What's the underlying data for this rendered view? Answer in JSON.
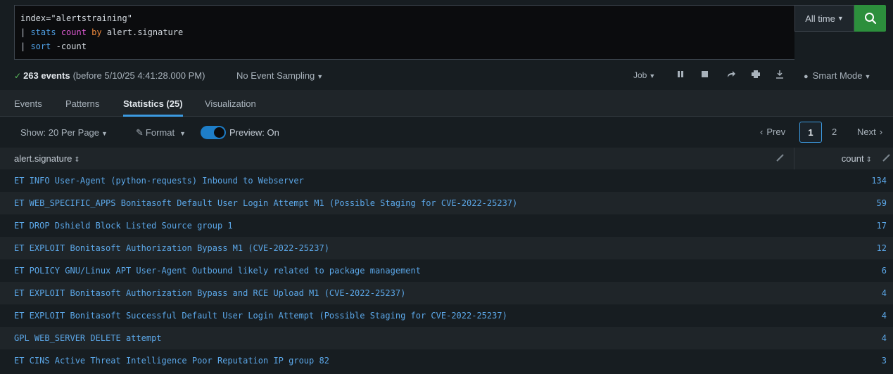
{
  "search": {
    "line1_prefix": "index=",
    "line1_value": "\"alertstraining\"",
    "line2_pipe": "| ",
    "line2_cmd": "stats",
    "line2_fn": "count",
    "line2_by": "by",
    "line2_field": "alert.signature",
    "line3_pipe": "| ",
    "line3_cmd": "sort",
    "line3_arg": "-count",
    "time_range": "All time",
    "accent": "#2c8f3c"
  },
  "status": {
    "events_count": "263 events",
    "events_detail": "(before 5/10/25 4:41:28.000 PM)",
    "sampling": "No Event Sampling",
    "job": "Job",
    "mode": "Smart Mode"
  },
  "tabs": [
    {
      "label": "Events"
    },
    {
      "label": "Patterns"
    },
    {
      "label": "Statistics (25)"
    },
    {
      "label": "Visualization"
    }
  ],
  "controls": {
    "per_page": "Show: 20 Per Page",
    "format": "Format",
    "preview": "Preview: On",
    "prev": "Prev",
    "page1": "1",
    "page2": "2",
    "next": "Next"
  },
  "table": {
    "col_signature": "alert.signature",
    "col_count": "count",
    "rows": [
      {
        "signature": "ET INFO User-Agent (python-requests) Inbound to Webserver",
        "count": "134"
      },
      {
        "signature": "ET WEB_SPECIFIC_APPS Bonitasoft Default User Login Attempt M1 (Possible Staging for CVE-2022-25237)",
        "count": "59"
      },
      {
        "signature": "ET DROP Dshield Block Listed Source group 1",
        "count": "17"
      },
      {
        "signature": "ET EXPLOIT Bonitasoft Authorization Bypass M1 (CVE-2022-25237)",
        "count": "12"
      },
      {
        "signature": "ET POLICY GNU/Linux APT User-Agent Outbound likely related to package management",
        "count": "6"
      },
      {
        "signature": "ET EXPLOIT Bonitasoft Authorization Bypass and RCE Upload M1 (CVE-2022-25237)",
        "count": "4"
      },
      {
        "signature": "ET EXPLOIT Bonitasoft Successful Default User Login Attempt (Possible Staging for CVE-2022-25237)",
        "count": "4"
      },
      {
        "signature": "GPL WEB_SERVER DELETE attempt",
        "count": "4"
      },
      {
        "signature": "ET CINS Active Threat Intelligence Poor Reputation IP group 82",
        "count": "3"
      }
    ]
  }
}
